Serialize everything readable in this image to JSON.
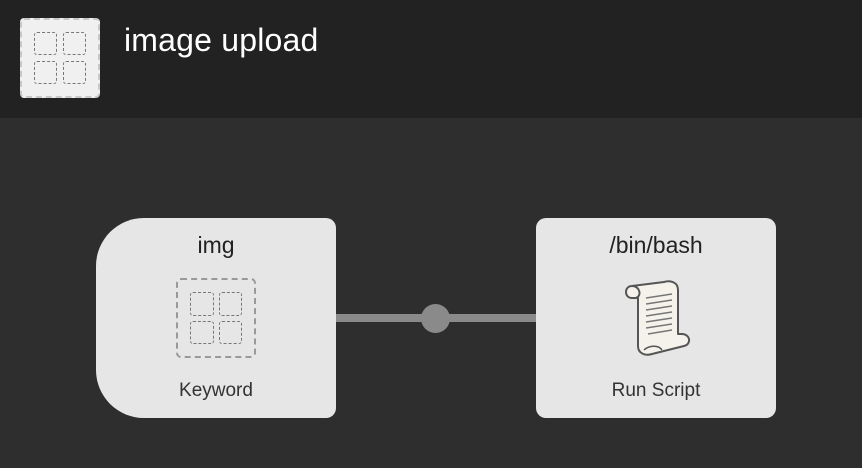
{
  "workflow": {
    "title": "image upload",
    "icon": "image-grid-icon"
  },
  "nodes": [
    {
      "id": "keyword",
      "title": "img",
      "subtitle": "Keyword",
      "icon": "image-grid-icon"
    },
    {
      "id": "script",
      "title": "/bin/bash",
      "subtitle": "Run Script",
      "icon": "scroll-icon"
    }
  ],
  "colors": {
    "header_bg": "#222222",
    "canvas_bg": "#2e2e2e",
    "node_bg": "#e6e6e6",
    "connector": "#8a8a8a"
  }
}
